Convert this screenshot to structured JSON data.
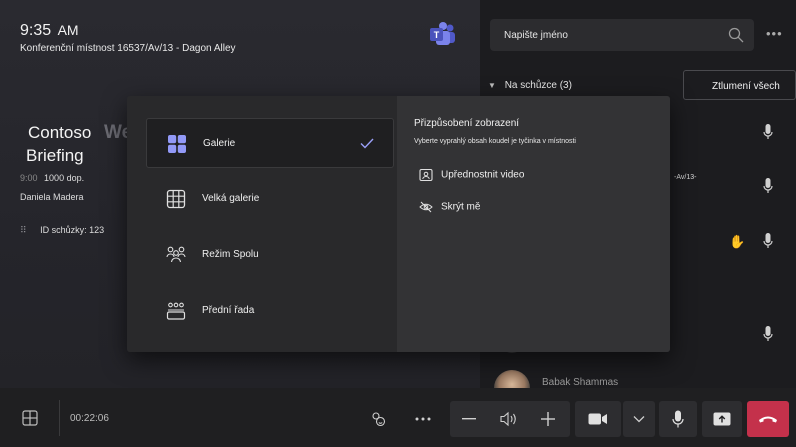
{
  "header": {
    "time": "9:35",
    "ampm": "AM",
    "room": "Konferenční místnost 16537/Av/13 - Dagon Alley"
  },
  "meeting": {
    "title_line1": "Contoso",
    "title_ghost": "We",
    "title_line2": "Briefing",
    "time_prefix": "9:00",
    "time": "1000 dop.",
    "host": "Daniela Madera",
    "id_label": "ID schůzky: 123"
  },
  "side_panel": {
    "search_placeholder": "Napište jméno",
    "section_label": "Na schůzce (3)",
    "mute_all": "Ztlumení všech",
    "partial_text": "-Av/13-",
    "participant_name": "Babak Shammas"
  },
  "layout_menu": {
    "options": [
      {
        "label": "Galerie",
        "icon": "gallery-icon",
        "selected": true
      },
      {
        "label": "Velká galerie",
        "icon": "large-gallery-icon",
        "selected": false
      },
      {
        "label": "Režim Spolu",
        "icon": "together-mode-icon",
        "selected": false
      },
      {
        "label": "Přední řada",
        "icon": "front-row-icon",
        "selected": false
      }
    ],
    "customize_title": "Přizpůsobení zobrazení",
    "customize_sub": "Vyberte vyprahlý obsah koudel je tyčinka v místnosti",
    "actions": [
      {
        "label": "Upřednostnit video",
        "icon": "prioritize-video-icon"
      },
      {
        "label": "Skrýt mě",
        "icon": "hide-me-icon"
      }
    ]
  },
  "bottom_bar": {
    "timer": "00:22:06"
  },
  "colors": {
    "accent": "#7f85f5",
    "end_call": "#c4314b",
    "hand": "#e0a030"
  }
}
